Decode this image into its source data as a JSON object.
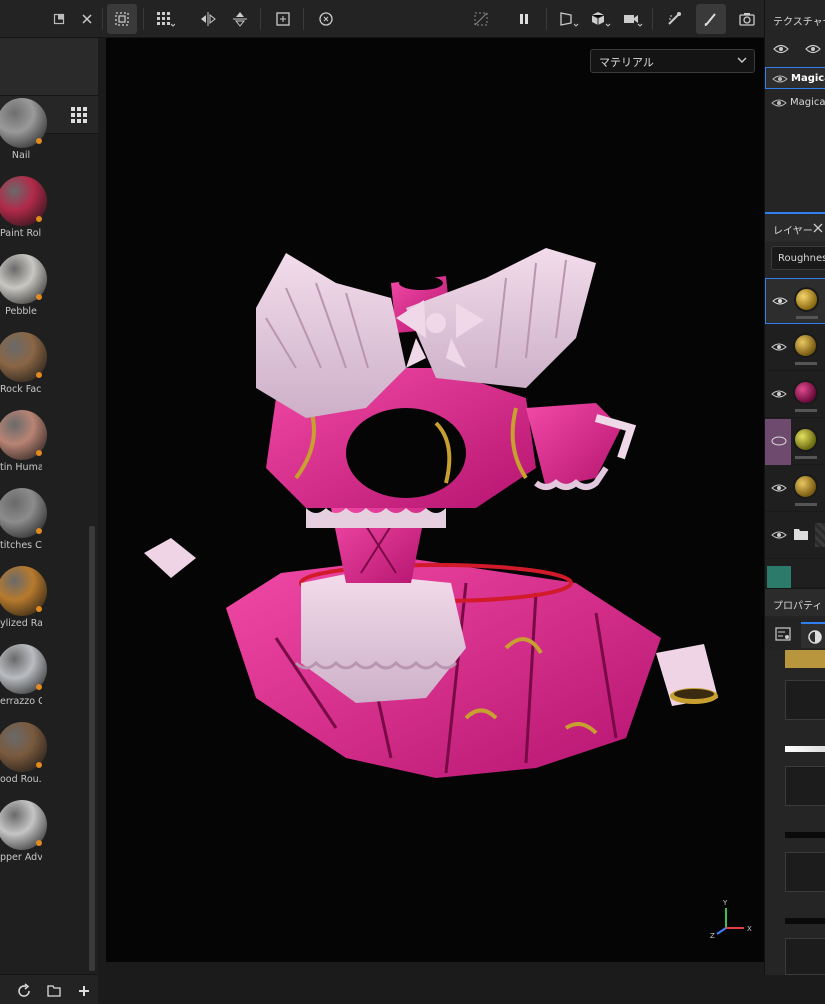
{
  "shelf": {
    "materials": [
      {
        "label": "Nail",
        "color": "#9a9a9a"
      },
      {
        "label": "Paint Roll",
        "color": "#b12a4a"
      },
      {
        "label": "Pebble",
        "color": "#c9c7c2"
      },
      {
        "label": "Rock Face",
        "color": "#8a6645"
      },
      {
        "label": "tin Huma...",
        "color": "#b88474"
      },
      {
        "label": "titches Cr...",
        "color": "#8c8c8c"
      },
      {
        "label": "ylized Ra...",
        "color": "#b77a2d"
      },
      {
        "label": "errazzo C...",
        "color": "#b9bcc0"
      },
      {
        "label": "ood Rou...",
        "color": "#7a5a3e"
      },
      {
        "label": "pper Adv...",
        "color": "#c5c5c5"
      }
    ]
  },
  "viewport": {
    "display_mode": "マテリアル"
  },
  "right_panel": {
    "texture_set_title": "テクスチャセッ",
    "texture_sets": [
      "Magica",
      "Magica"
    ],
    "layers_title": "レイヤー",
    "channel_value": "Roughnes",
    "properties_title": "プロパティ -"
  },
  "colors": {
    "accent": "#2f7ff0",
    "swatch": "#b8963e"
  }
}
